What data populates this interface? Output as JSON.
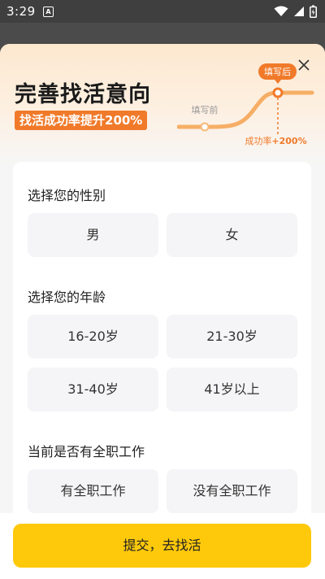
{
  "status": {
    "time": "3:29",
    "notification_glyph": "A",
    "icons": [
      "wifi-icon",
      "signal-icon",
      "battery-icon"
    ]
  },
  "header": {
    "title": "完善找活意向",
    "badge": "找活成功率提升200%",
    "before_label": "填写前",
    "after_label": "填写后",
    "rate_label": "成功率",
    "rate_value": "+200%",
    "accent_color": "#f07a2a"
  },
  "gender": {
    "title": "选择您的性别",
    "options": [
      "男",
      "女"
    ]
  },
  "age": {
    "title": "选择您的年龄",
    "options": [
      "16-20岁",
      "21-30岁",
      "31-40岁",
      "41岁以上"
    ]
  },
  "job": {
    "title": "当前是否有全职工作",
    "options": [
      "有全职工作",
      "没有全职工作"
    ]
  },
  "submit_label": "提交，去找活",
  "submit_color": "#ffc90b"
}
